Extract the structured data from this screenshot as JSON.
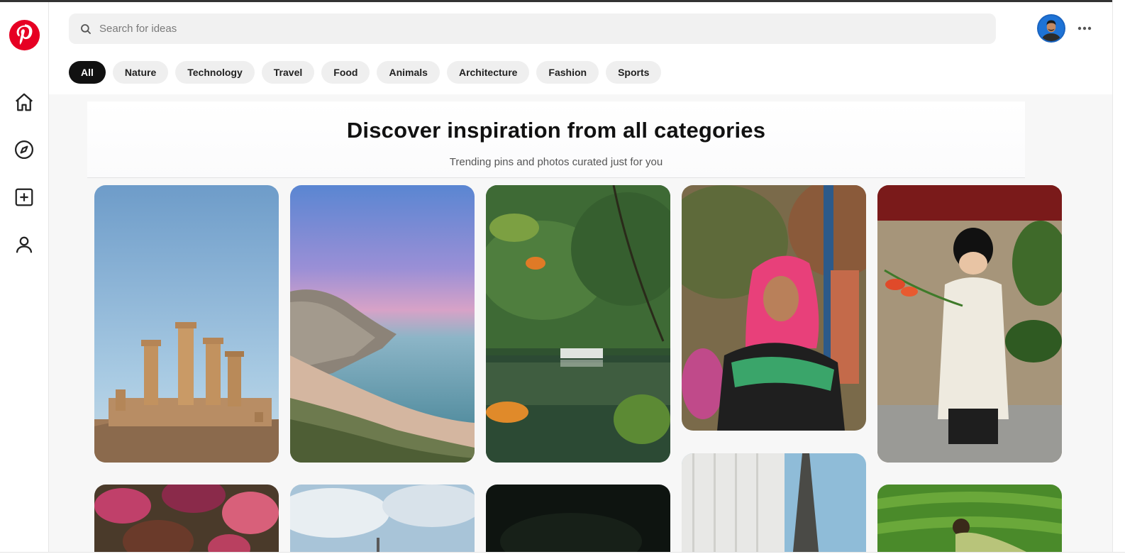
{
  "app": {
    "brand_color": "#e60023",
    "logo_icon": "pinterest-logo"
  },
  "sidebar": {
    "items": [
      {
        "name": "home",
        "icon": "home-icon"
      },
      {
        "name": "explore",
        "icon": "compass-icon"
      },
      {
        "name": "create",
        "icon": "plus-square-icon"
      },
      {
        "name": "profile",
        "icon": "user-icon"
      }
    ]
  },
  "header": {
    "search": {
      "placeholder": "Search for ideas",
      "value": ""
    },
    "avatar_icon": "user-avatar",
    "more_icon": "ellipsis-icon"
  },
  "categories": [
    {
      "label": "All",
      "active": true
    },
    {
      "label": "Nature",
      "active": false
    },
    {
      "label": "Technology",
      "active": false
    },
    {
      "label": "Travel",
      "active": false
    },
    {
      "label": "Food",
      "active": false
    },
    {
      "label": "Animals",
      "active": false
    },
    {
      "label": "Architecture",
      "active": false
    },
    {
      "label": "Fashion",
      "active": false
    },
    {
      "label": "Sports",
      "active": false
    }
  ],
  "hero": {
    "title": "Discover inspiration from all categories",
    "subtitle": "Trending pins and photos curated just for you"
  },
  "pins": [
    {
      "subject": "ancient-temple-columns"
    },
    {
      "subject": "coastal-beach-sunset"
    },
    {
      "subject": "forest-lake"
    },
    {
      "subject": "woman-pink-headscarf"
    },
    {
      "subject": "child-white-dress-flowers"
    },
    {
      "subject": "pink-blossoms"
    },
    {
      "subject": "cloudy-sky-tower"
    },
    {
      "subject": "dark-scene"
    },
    {
      "subject": "skyscraper-and-spire"
    },
    {
      "subject": "person-in-green-field"
    }
  ]
}
